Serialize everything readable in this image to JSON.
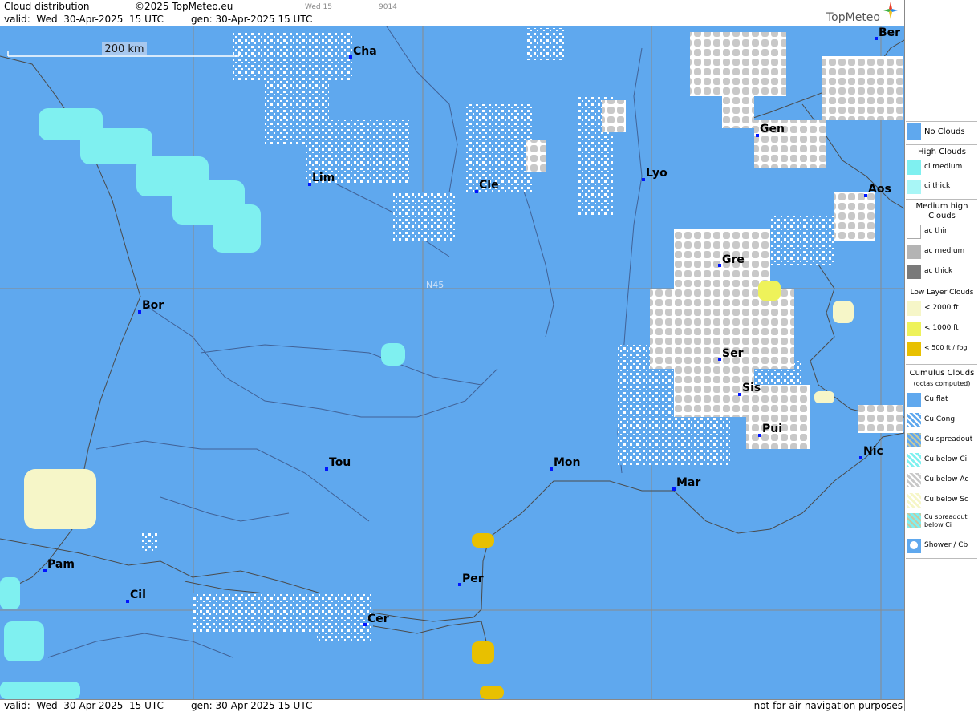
{
  "header": {
    "title": "Cloud distribution",
    "copyright": "©2025 TopMeteo.eu",
    "valid": "valid:  Wed  30-Apr-2025  15 UTC",
    "gen": "gen: 30-Apr-2025 15 UTC",
    "tag_day": "Wed 15",
    "tag_code": "9014",
    "logo": "TopMeteo"
  },
  "footer": {
    "valid": "valid:  Wed  30-Apr-2025  15 UTC",
    "gen": "gen: 30-Apr-2025 15 UTC",
    "disclaimer": "not for air navigation purposes"
  },
  "map": {
    "scale_label": "200 km",
    "latitude_label": "N45",
    "cities": [
      "Cha",
      "Ber",
      "Gen",
      "Lim",
      "Cle",
      "Lyo",
      "Aos",
      "Gre",
      "Bor",
      "N45",
      "Ser",
      "Sis",
      "Pui",
      "Tou",
      "Mon",
      "Mar",
      "Nic",
      "Pam",
      "Cil",
      "Per",
      "Cer"
    ]
  },
  "legend": {
    "no_clouds": "No Clouds",
    "high_clouds": "High Clouds",
    "ci_medium": "ci medium",
    "ci_thick": "ci thick",
    "medium_high": "Medium high Clouds",
    "ac_thin": "ac thin",
    "ac_medium": "ac medium",
    "ac_thick": "ac thick",
    "low_layer": "Low Layer Clouds",
    "low_2000": "< 2000 ft",
    "low_1000": "< 1000 ft",
    "low_500": "< 500 ft / fog",
    "cumulus": "Cumulus Clouds",
    "cumulus_sub": "(octas computed)",
    "cu_flat": "Cu flat",
    "cu_cong": "Cu Cong",
    "cu_spreadout": "Cu spreadout",
    "cu_below_ci": "Cu below Ci",
    "cu_below_ac": "Cu below Ac",
    "cu_below_sc": "Cu below Sc",
    "cu_spreadout_below_ci": "Cu spreadout below Ci",
    "shower_cb": "Shower / Cb"
  },
  "colors": {
    "no_clouds": "#5fa8ee",
    "ci": "#7ff0f0",
    "ac_medium": "#c8c8c8",
    "ac_thick": "#9a9a9a",
    "low_2000": "#f6f6c8",
    "low_1000": "#eef25a",
    "low_500": "#e8c000"
  }
}
